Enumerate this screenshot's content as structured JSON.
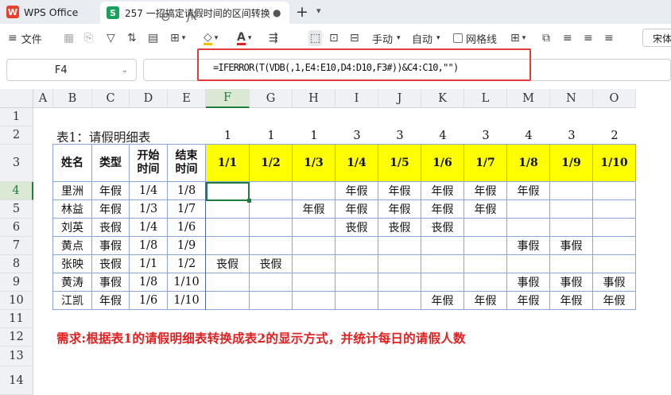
{
  "tabs": {
    "app_label": "WPS Office",
    "doc_label": "257 一招搞定请假时间的区间转换",
    "doc_icon": "S"
  },
  "toolbar": {
    "file_label": "文件",
    "manual_label": "手动",
    "auto_label": "自动",
    "gridlines_label": "网格线",
    "font_value": "宋体"
  },
  "formula_bar": {
    "name_box": "F4",
    "formula": "=IFERROR(T(VDB(,1,E4:E10,D4:D10,F3#))&C4:C10,\"\")"
  },
  "sheet": {
    "columns": [
      "A",
      "B",
      "C",
      "D",
      "E",
      "F",
      "G",
      "H",
      "I",
      "J",
      "K",
      "L",
      "M",
      "N",
      "O"
    ],
    "active_column": "F",
    "rows": [
      "1",
      "2",
      "3",
      "4",
      "5",
      "6",
      "7",
      "8",
      "9",
      "10",
      "11",
      "12",
      "13",
      "14"
    ],
    "active_row": "4",
    "table_title": "表1：请假明细表",
    "daily_counts": [
      "1",
      "1",
      "1",
      "3",
      "3",
      "4",
      "3",
      "4",
      "3",
      "2"
    ],
    "header_name": "姓名",
    "header_type": "类型",
    "header_start": "开始\n时间",
    "header_end": "结束\n时间",
    "dates": [
      "1/1",
      "1/2",
      "1/3",
      "1/4",
      "1/5",
      "1/6",
      "1/7",
      "1/8",
      "1/9",
      "1/10"
    ],
    "records": [
      {
        "name": "里洲",
        "type": "年假",
        "start": "1/4",
        "end": "1/8",
        "days": [
          "",
          "",
          "",
          "年假",
          "年假",
          "年假",
          "年假",
          "年假",
          "",
          ""
        ]
      },
      {
        "name": "林益",
        "type": "年假",
        "start": "1/3",
        "end": "1/7",
        "days": [
          "",
          "",
          "年假",
          "年假",
          "年假",
          "年假",
          "年假",
          "",
          "",
          ""
        ]
      },
      {
        "name": "刘英",
        "type": "丧假",
        "start": "1/4",
        "end": "1/6",
        "days": [
          "",
          "",
          "",
          "丧假",
          "丧假",
          "丧假",
          "",
          "",
          "",
          ""
        ]
      },
      {
        "name": "黄点",
        "type": "事假",
        "start": "1/8",
        "end": "1/9",
        "days": [
          "",
          "",
          "",
          "",
          "",
          "",
          "",
          "事假",
          "事假",
          ""
        ]
      },
      {
        "name": "张映",
        "type": "丧假",
        "start": "1/1",
        "end": "1/2",
        "days": [
          "丧假",
          "丧假",
          "",
          "",
          "",
          "",
          "",
          "",
          "",
          ""
        ]
      },
      {
        "name": "黄涛",
        "type": "事假",
        "start": "1/8",
        "end": "1/10",
        "days": [
          "",
          "",
          "",
          "",
          "",
          "",
          "",
          "事假",
          "事假",
          "事假"
        ]
      },
      {
        "name": "江凯",
        "type": "年假",
        "start": "1/6",
        "end": "1/10",
        "days": [
          "",
          "",
          "",
          "",
          "",
          "年假",
          "年假",
          "年假",
          "年假",
          "年假"
        ]
      }
    ],
    "requirement": "需求:根据表1的请假明细表转换成表2的显示方式，并统计每日的请假人数"
  }
}
